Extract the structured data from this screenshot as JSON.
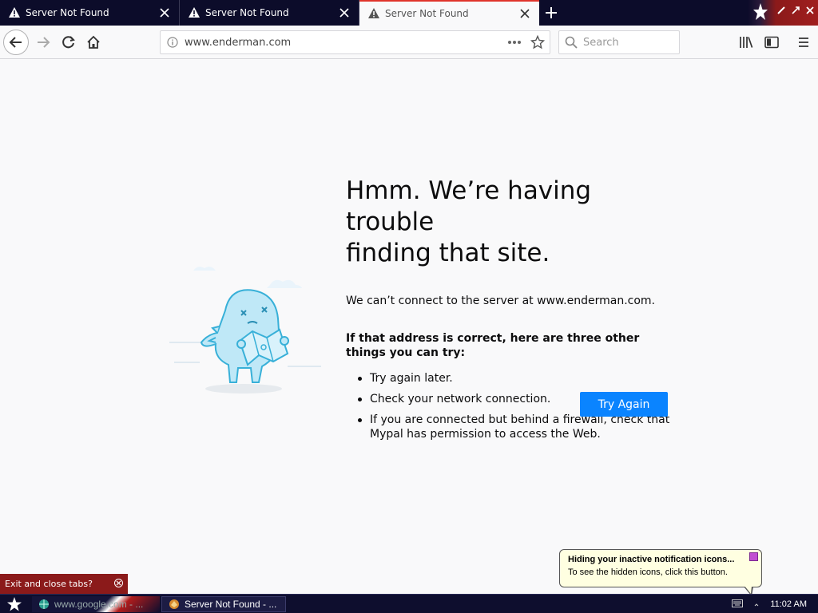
{
  "tabs": [
    {
      "title": "Server Not Found",
      "state": "inactive"
    },
    {
      "title": "Server Not Found",
      "state": "inactive"
    },
    {
      "title": "Server Not Found",
      "state": "active"
    }
  ],
  "toolbar": {
    "url": "www.enderman.com",
    "search_placeholder": "Search"
  },
  "error": {
    "title_line1": "Hmm. We’re having trouble",
    "title_line2": "finding that site.",
    "description": "We can’t connect to the server at www.enderman.com.",
    "suggest_heading": "If that address is correct, here are three other things you can try:",
    "suggestions": [
      "Try again later.",
      "Check your network connection.",
      "If you are connected but behind a firewall, check that Mypal has permission to access the Web."
    ],
    "button_label": "Try Again"
  },
  "notifications": {
    "exit_toast": "Exit and close tabs?",
    "balloon_title": "Hiding your inactive notification icons...",
    "balloon_body": "To see the hidden icons, click this button."
  },
  "taskbar": {
    "task1_label": "www.google.com - ...",
    "task2_label": "Server Not Found - ...",
    "clock": "11:02 AM"
  },
  "colors": {
    "accent": "#0a84ff",
    "tabstrip": "#0c0c2a",
    "taskbar": "#0e0e2e",
    "toast": "#8b1a1a"
  }
}
